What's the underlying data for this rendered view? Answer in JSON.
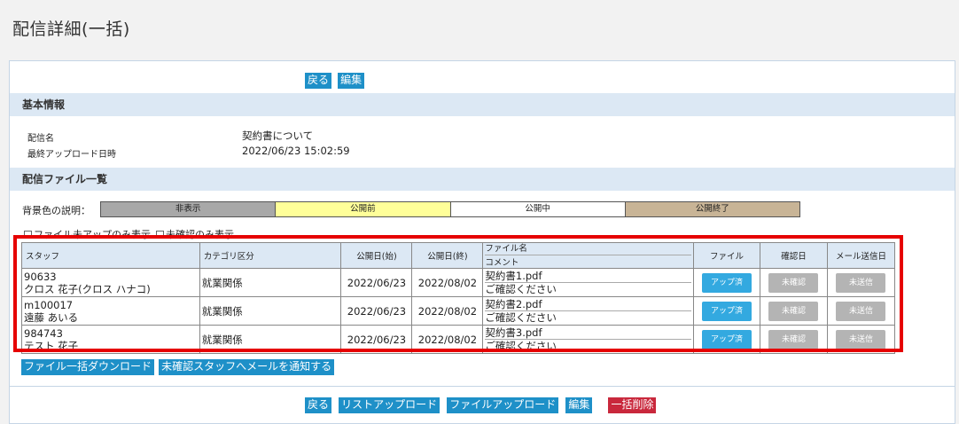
{
  "page": {
    "title": "配信詳細(一括)"
  },
  "top_buttons": {
    "back": "戻る",
    "edit": "編集"
  },
  "basic_info": {
    "header": "基本情報",
    "name_label": "配信名",
    "name_value": "契約書について",
    "upload_label": "最終アップロード日時",
    "upload_value": "2022/06/23 15:02:59"
  },
  "file_list": {
    "header": "配信ファイル一覧"
  },
  "legend": {
    "label": "背景色の説明：",
    "items": [
      {
        "text": "非表示",
        "color": "#a8a8a8"
      },
      {
        "text": "公開前",
        "color": "#ffff99"
      },
      {
        "text": "公開中",
        "color": "#ffffff"
      },
      {
        "text": "公開終了",
        "color": "#c8b496"
      }
    ]
  },
  "filters": {
    "not_uploaded": "ファイル未アップのみ表示",
    "unconfirmed": "未確認のみ表示"
  },
  "table": {
    "headers": {
      "staff": "スタッフ",
      "category": "カテゴリ区分",
      "start": "公開日(始)",
      "end": "公開日(終)",
      "filename": "ファイル名",
      "comment": "コメント",
      "file": "ファイル",
      "confirm": "確認日",
      "mail": "メール送信日"
    },
    "rows": [
      {
        "id": "90633",
        "name": "クロス 花子(クロス ハナコ)",
        "category": "就業関係",
        "start": "2022/06/23",
        "end": "2022/08/02",
        "file": "契約書1.pdf",
        "comment": "ご確認ください",
        "file_status": "アップ済",
        "confirm_status": "未確認",
        "mail_status": "未送信"
      },
      {
        "id": "m100017",
        "name": "遠藤 あいる",
        "category": "就業関係",
        "start": "2022/06/23",
        "end": "2022/08/02",
        "file": "契約書2.pdf",
        "comment": "ご確認ください",
        "file_status": "アップ済",
        "confirm_status": "未確認",
        "mail_status": "未送信"
      },
      {
        "id": "984743",
        "name": "テスト 花子",
        "category": "就業関係",
        "start": "2022/06/23",
        "end": "2022/08/02",
        "file": "契約書3.pdf",
        "comment": "ご確認ください",
        "file_status": "アップ済",
        "confirm_status": "未確認",
        "mail_status": "未送信"
      }
    ]
  },
  "table_buttons": {
    "bulk_download": "ファイル一括ダウンロード",
    "notify": "未確認スタッフへメールを通知する"
  },
  "bottom_buttons": {
    "back": "戻る",
    "list_upload": "リストアップロード",
    "file_upload": "ファイルアップロード",
    "edit": "編集",
    "bulk_delete": "一括削除"
  }
}
